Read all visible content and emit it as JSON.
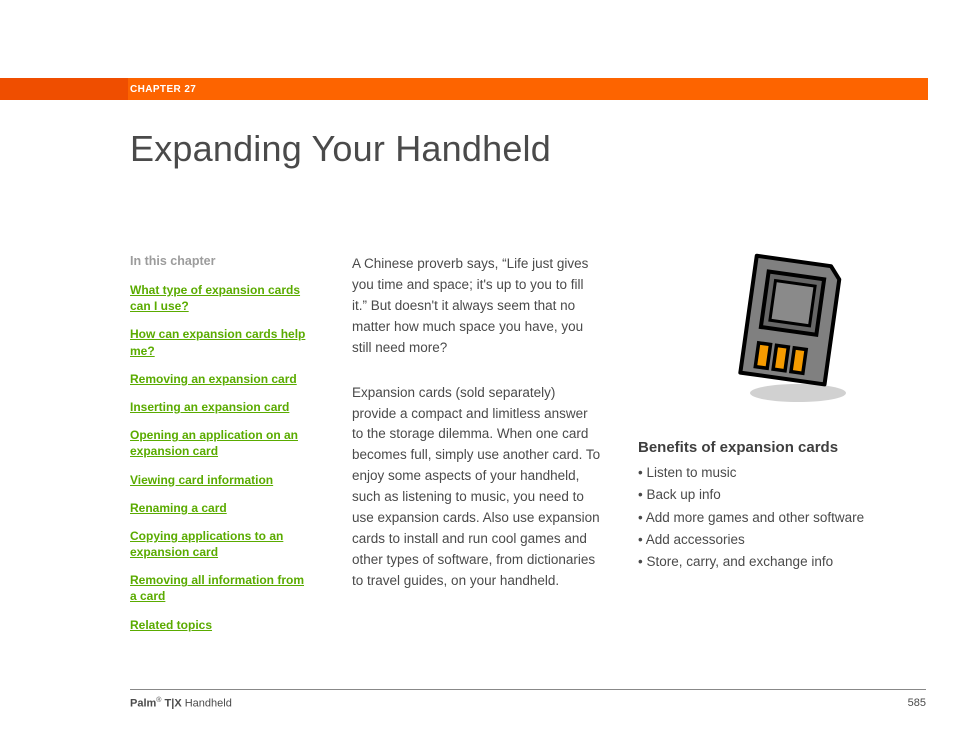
{
  "header": {
    "chapter_label": "CHAPTER 27"
  },
  "title": "Expanding Your Handheld",
  "sidebar": {
    "heading": "In this chapter",
    "links": [
      "What type of expansion cards can I use?",
      "How can expansion cards help me?",
      "Removing an expansion card",
      "Inserting an expansion card",
      "Opening an application on an expansion card",
      "Viewing card information",
      "Renaming a card",
      "Copying applications to an expansion card",
      "Removing all information from a card",
      "Related topics"
    ]
  },
  "body": {
    "p1": "A Chinese proverb says, “Life just gives you time and space; it's up to you to fill it.” But doesn't it always seem that no matter how much space you have, you still need more?",
    "p2": "Expansion cards (sold separately) provide a compact and limitless answer to the storage dilemma. When one card becomes full, simply use another card. To enjoy some aspects of your handheld, such as listening to music, you need to use expansion cards. Also use expansion cards to install and run cool games and other types of software, from dictionaries to travel guides, on your handheld."
  },
  "benefits": {
    "heading": "Benefits of expansion cards",
    "items": [
      "Listen to music",
      "Back up info",
      "Add more games and other software",
      "Add accessories",
      "Store, carry, and exchange info"
    ]
  },
  "footer": {
    "brand_bold": "Palm",
    "brand_reg": "®",
    "brand_model": " T|X",
    "brand_tail": " Handheld",
    "page": "585"
  }
}
